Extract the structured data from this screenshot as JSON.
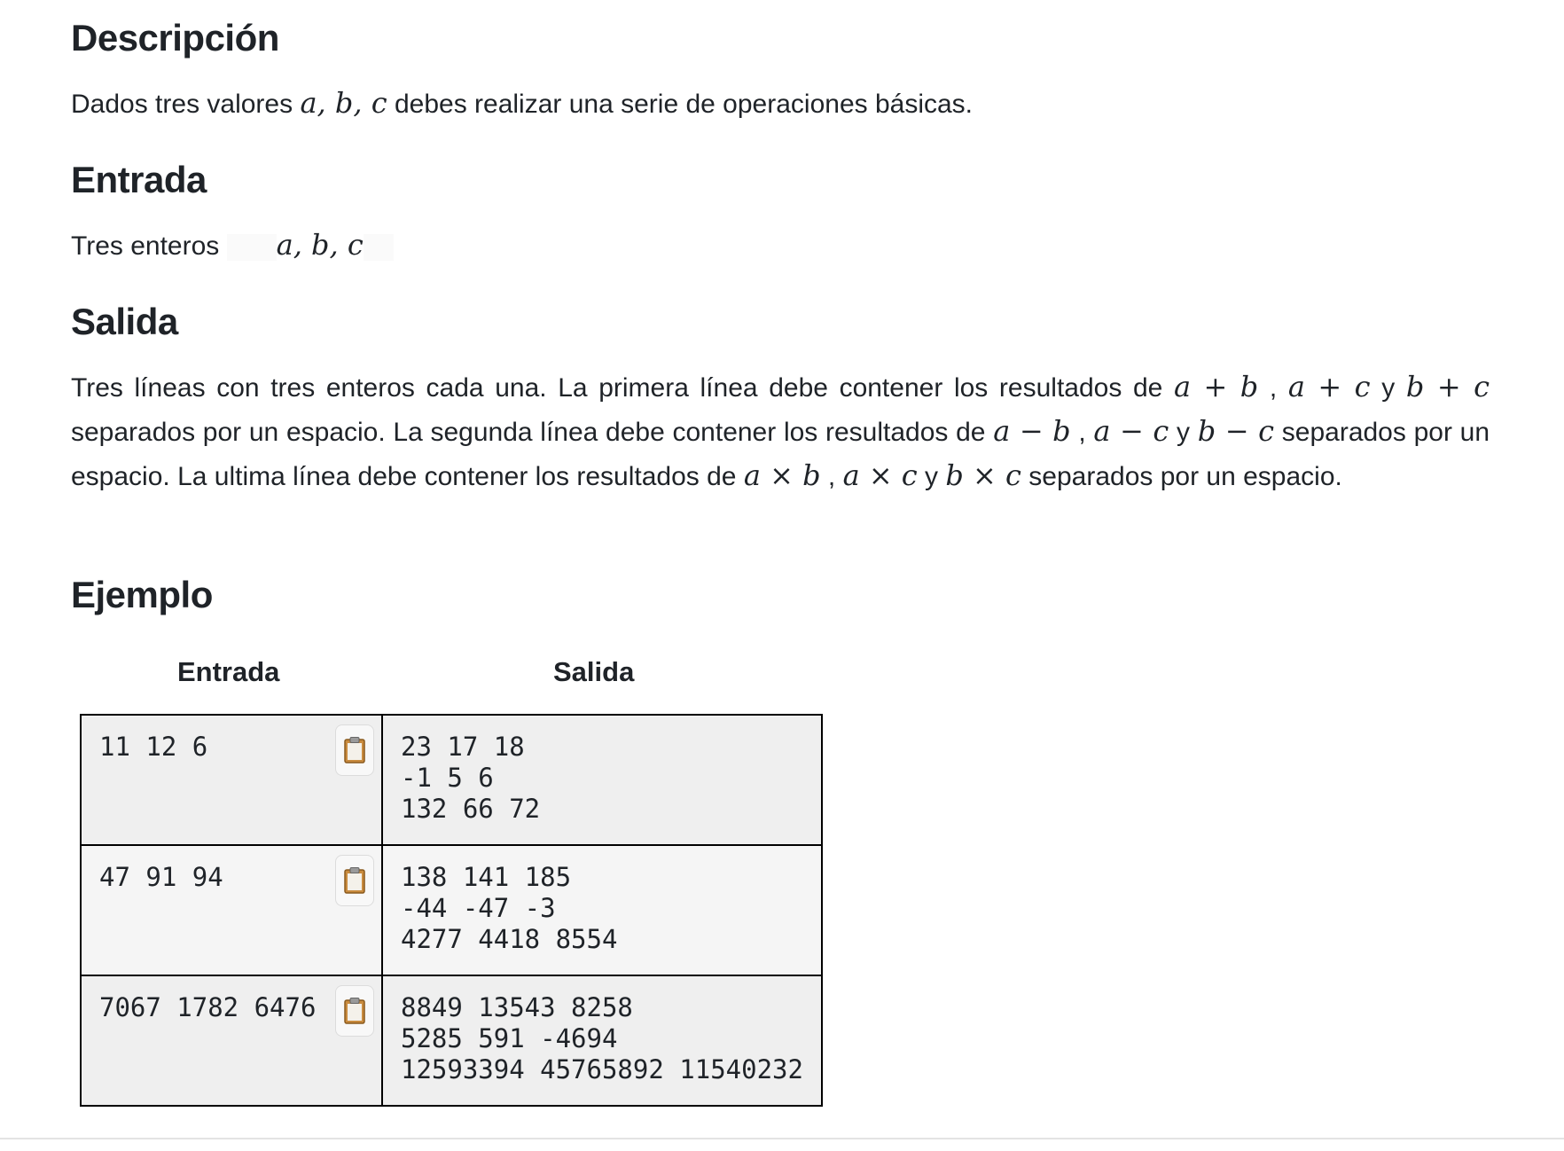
{
  "descripcion": {
    "heading": "Descripción",
    "text_before": "Dados tres valores ",
    "math": "a, b, c",
    "text_after": " debes realizar una serie de operaciones básicas."
  },
  "entrada": {
    "heading": "Entrada",
    "text": "Tres enteros ",
    "math": "a, b, c"
  },
  "salida": {
    "heading": "Salida",
    "t1": "Tres líneas con tres enteros cada una. La primera línea debe contener los resultados de ",
    "m1": "a + b",
    "t2": " , ",
    "m2": "a + c",
    "t3": " y ",
    "m3": "b + c",
    "t4": " separados por un espacio. La segunda línea debe contener los resultados de ",
    "m4": "a − b",
    "t5": " , ",
    "m5": "a − c",
    "t6": " y ",
    "m6": "b − c",
    "t7": " separados por un espacio. La ultima línea debe contener los resultados de ",
    "m7": "a × b",
    "t8": " , ",
    "m8": "a × c",
    "t9": " y ",
    "m9": "b × c",
    "t10": " separados por un espacio."
  },
  "ejemplo": {
    "heading": "Ejemplo",
    "col_entrada": "Entrada",
    "col_salida": "Salida",
    "rows": [
      {
        "input": "11 12 6",
        "output": [
          "23 17 18",
          "-1 5 6",
          "132 66 72"
        ]
      },
      {
        "input": "47 91 94",
        "output": [
          "138 141 185",
          "-44 -47 -3",
          "4277 4418 8554"
        ]
      },
      {
        "input": "7067 1782 6476",
        "output": [
          "8849 13543 8258",
          "5285 591 -4694",
          "12593394 45765892 11540232"
        ]
      }
    ]
  },
  "icons": {
    "copy": "clipboard-icon"
  }
}
